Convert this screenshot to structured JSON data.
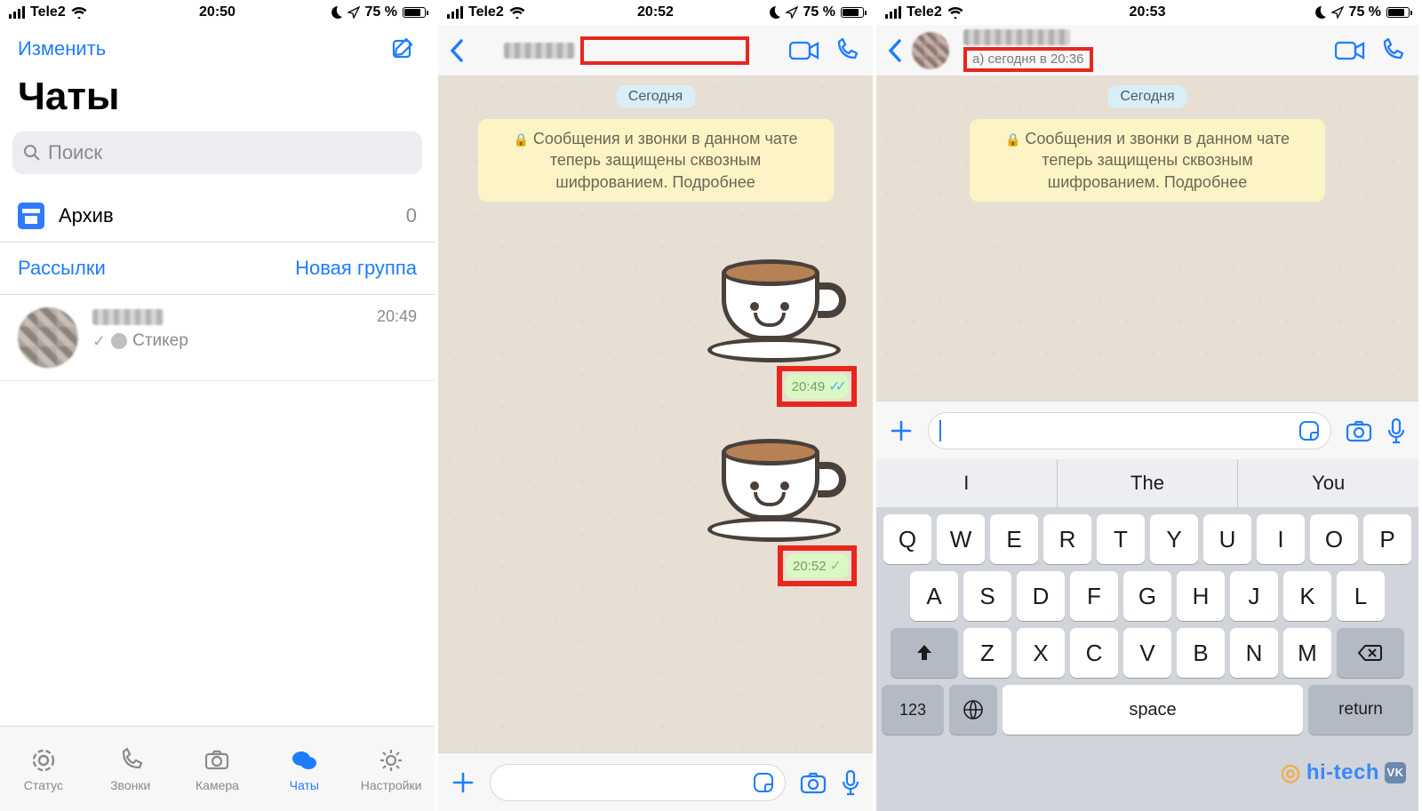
{
  "statusbar": {
    "carrier": "Tele2",
    "time1": "20:50",
    "time2": "20:52",
    "time3": "20:53",
    "batt": "75 %"
  },
  "p1": {
    "edit": "Изменить",
    "title": "Чаты",
    "search_placeholder": "Поиск",
    "archive": "Архив",
    "archive_count": "0",
    "broadcasts": "Рассылки",
    "new_group": "Новая группа",
    "chat_time": "20:49",
    "chat_preview": "Стикер",
    "tabs": {
      "status": "Статус",
      "calls": "Звонки",
      "camera": "Камера",
      "chats": "Чаты",
      "settings": "Настройки"
    }
  },
  "p2": {
    "date_pill": "Сегодня",
    "enc_text": "Сообщения и звонки в данном чате теперь защищены сквозным шифрованием. Подробнее",
    "msg1_time": "20:49",
    "msg2_time": "20:52"
  },
  "p3": {
    "last_seen": "а) сегодня в 20:36",
    "date_pill": "Сегодня",
    "enc_text": "Сообщения и звонки в данном чате теперь защищены сквозным шифрованием. Подробнее",
    "sugg1": "I",
    "sugg2": "The",
    "sugg3": "You",
    "row1": [
      "Q",
      "W",
      "E",
      "R",
      "T",
      "Y",
      "U",
      "I",
      "O",
      "P"
    ],
    "row2": [
      "A",
      "S",
      "D",
      "F",
      "G",
      "H",
      "J",
      "K",
      "L"
    ],
    "row3": [
      "Z",
      "X",
      "C",
      "V",
      "B",
      "N",
      "M"
    ],
    "k123": "123",
    "kspace": "space",
    "kreturn": "return"
  },
  "watermark": "hi-tech"
}
